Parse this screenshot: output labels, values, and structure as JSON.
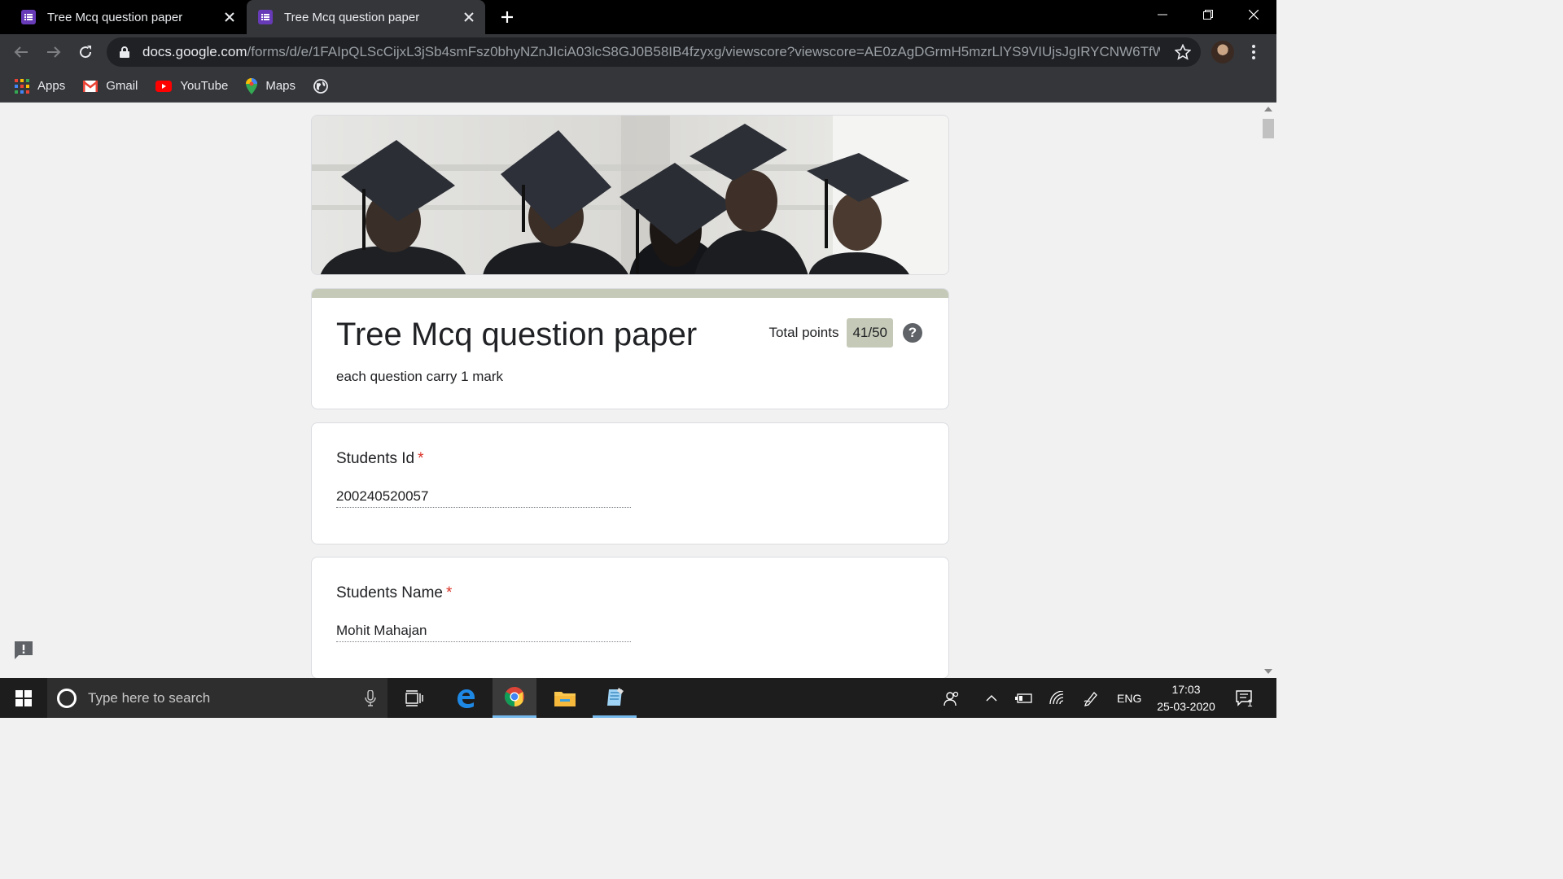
{
  "browser": {
    "tabs": [
      {
        "title": "Tree Mcq question paper",
        "active": false
      },
      {
        "title": "Tree Mcq question paper",
        "active": true
      }
    ],
    "url_host": "docs.google.com",
    "url_path": "/forms/d/e/1FAIpQLScCijxL3jSb4smFsz0bhyNZnJIciA03lcS8GJ0B58IB4fzyxg/viewscore?viewscore=AE0zAgDGrmH5mzrLlYS9VIUjsJgIRYCNW6TfWLK...",
    "bookmarks": [
      {
        "label": "Apps",
        "icon": "apps-grid-icon"
      },
      {
        "label": "Gmail",
        "icon": "gmail-icon"
      },
      {
        "label": "YouTube",
        "icon": "youtube-icon"
      },
      {
        "label": "Maps",
        "icon": "maps-pin-icon"
      }
    ]
  },
  "form": {
    "title": "Tree Mcq question paper",
    "description": "each question carry 1 mark",
    "total_points_label": "Total points",
    "score": "41/50",
    "help_glyph": "?",
    "questions": [
      {
        "label": "Students Id",
        "required": "*",
        "answer": "200240520057"
      },
      {
        "label": "Students Name",
        "required": "*",
        "answer": "Mohit Mahajan"
      }
    ]
  },
  "taskbar": {
    "search_placeholder": "Type here to search",
    "language": "ENG",
    "time": "17:03",
    "date": "25-03-2020",
    "notification_count": "1"
  },
  "colors": {
    "form_accent": "#c5cab8",
    "required": "#d93025",
    "forms_purple": "#673ab7",
    "taskbar_accent": "#76b9ed"
  }
}
